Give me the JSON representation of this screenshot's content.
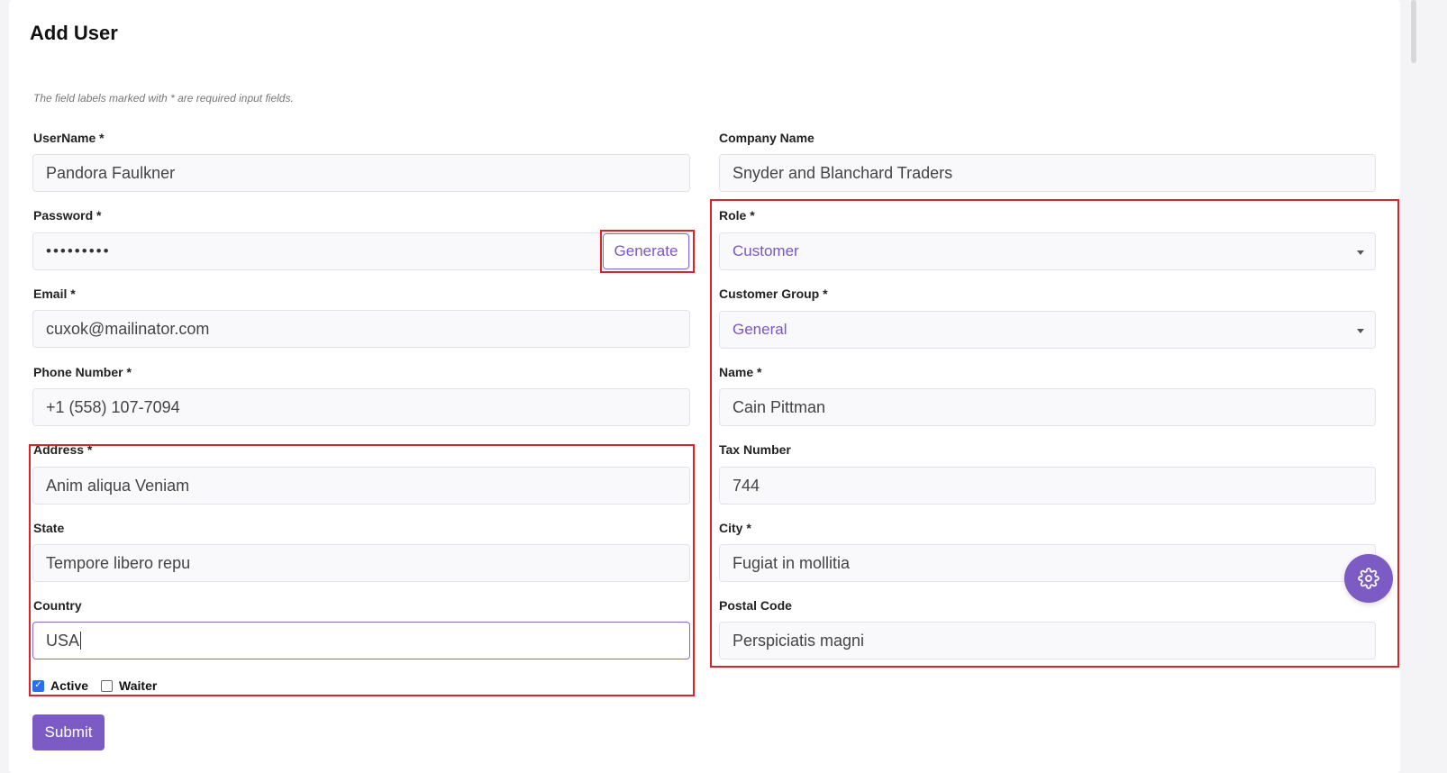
{
  "page": {
    "title": "Add User",
    "note": "The field labels marked with * are required input fields."
  },
  "form": {
    "username": {
      "label": "UserName *",
      "value": "Pandora Faulkner"
    },
    "password": {
      "label": "Password *",
      "value": "•••••••••",
      "generate_label": "Generate"
    },
    "email": {
      "label": "Email *",
      "value": "cuxok@mailinator.com"
    },
    "phone": {
      "label": "Phone Number *",
      "value": "+1 (558) 107-7094"
    },
    "address": {
      "label": "Address *",
      "value": "Anim aliqua Veniam"
    },
    "state": {
      "label": "State",
      "value": "Tempore libero repu"
    },
    "country": {
      "label": "Country",
      "value": "USA"
    },
    "company": {
      "label": "Company Name",
      "value": "Snyder and Blanchard Traders"
    },
    "role": {
      "label": "Role *",
      "value": "Customer"
    },
    "customer_group": {
      "label": "Customer Group *",
      "value": "General"
    },
    "name": {
      "label": "Name *",
      "value": "Cain Pittman"
    },
    "tax_number": {
      "label": "Tax Number",
      "value": "744"
    },
    "city": {
      "label": "City *",
      "value": "Fugiat in mollitia"
    },
    "postal_code": {
      "label": "Postal Code",
      "value": "Perspiciatis magni"
    },
    "active": {
      "label": "Active",
      "checked": true
    },
    "waiter": {
      "label": "Waiter",
      "checked": false
    },
    "submit_label": "Submit"
  },
  "icons": {
    "settings_fab": "gear-icon"
  },
  "colors": {
    "accent": "#7c5cc4",
    "highlight": "#e0202a",
    "checkbox": "#2a6ef2"
  }
}
